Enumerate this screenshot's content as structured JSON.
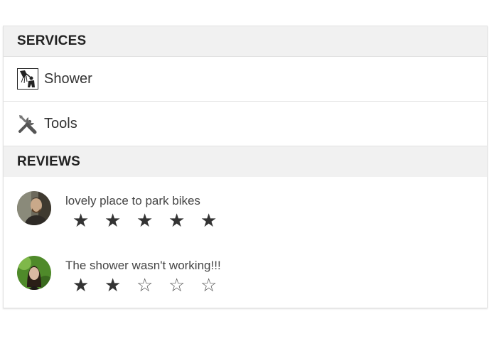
{
  "services": {
    "header": "SERVICES",
    "items": [
      {
        "label": "Shower",
        "icon": "shower-icon"
      },
      {
        "label": "Tools",
        "icon": "tools-icon"
      }
    ]
  },
  "reviews": {
    "header": "REVIEWS",
    "items": [
      {
        "text": "lovely place to park bikes",
        "rating": 5,
        "max_rating": 5
      },
      {
        "text": "The shower wasn't working!!!",
        "rating": 2,
        "max_rating": 5
      }
    ]
  },
  "glyphs": {
    "star_filled": "★",
    "star_empty": "☆"
  }
}
